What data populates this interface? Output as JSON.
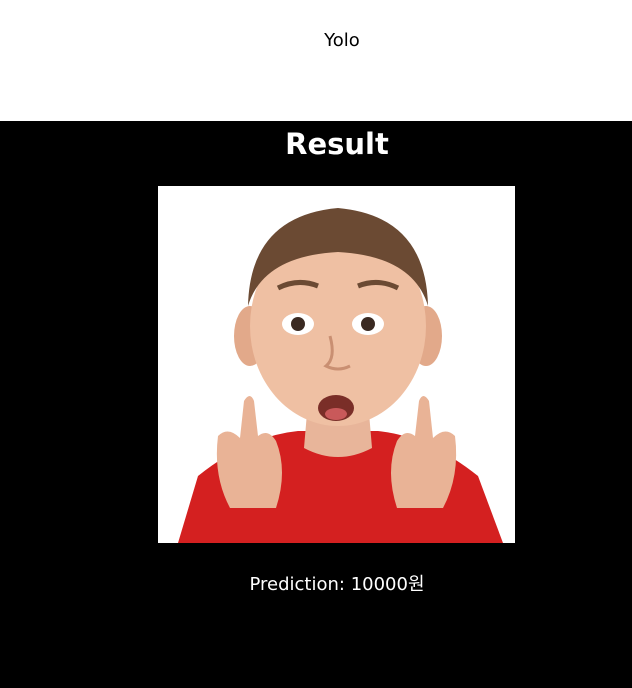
{
  "header": {
    "title": "Yolo"
  },
  "result": {
    "heading": "Result",
    "prediction_label": "Prediction: 10000원"
  },
  "image": {
    "subject": "surprised child pointing up",
    "background_color": "#ffffff",
    "shirt_color": "#d42020"
  },
  "colors": {
    "page_background": "#ffffff",
    "result_background": "#000000",
    "result_text": "#ffffff"
  }
}
